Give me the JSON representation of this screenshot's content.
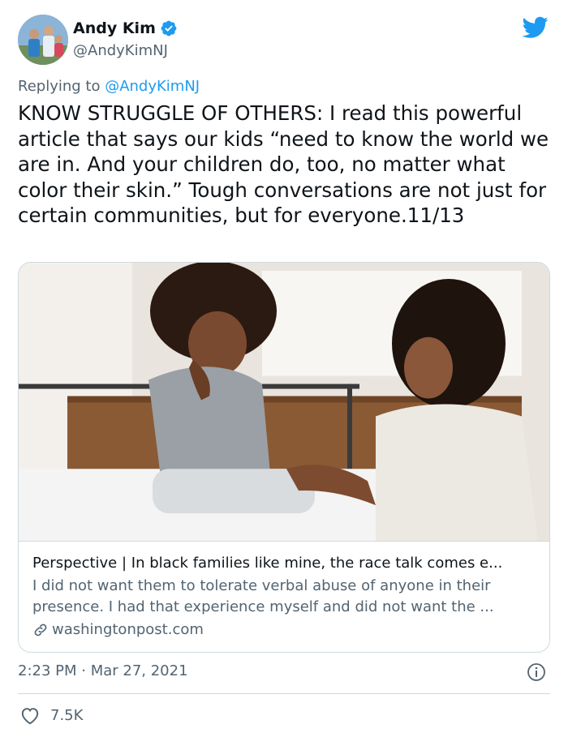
{
  "author": {
    "name": "Andy Kim",
    "handle": "@AndyKimNJ"
  },
  "reply": {
    "prefix": "Replying to ",
    "mention": "@AndyKimNJ"
  },
  "tweet": {
    "text": "KNOW STRUGGLE OF OTHERS: I read this powerful article that says our kids “need to know the world we are in. And your children do, too, no matter what color their skin.” Tough conversations are not just for certain communities, but for everyone.11/13"
  },
  "link_card": {
    "title": "Perspective | In black families like mine, the race talk comes e...",
    "description": "I did not want them to tolerate verbal abuse of anyone in their presence. I had that experience myself and did not want the ...",
    "domain": "washingtonpost.com"
  },
  "timestamp": "2:23 PM · Mar 27, 2021",
  "engagement": {
    "likes": "7.5K"
  },
  "colors": {
    "accent": "#1d9bf0",
    "text": "#0f1419",
    "secondary": "#536471",
    "border": "#cfd9de"
  },
  "icons": [
    "verified-badge-icon",
    "twitter-bird-icon",
    "link-icon",
    "info-icon",
    "heart-icon"
  ]
}
